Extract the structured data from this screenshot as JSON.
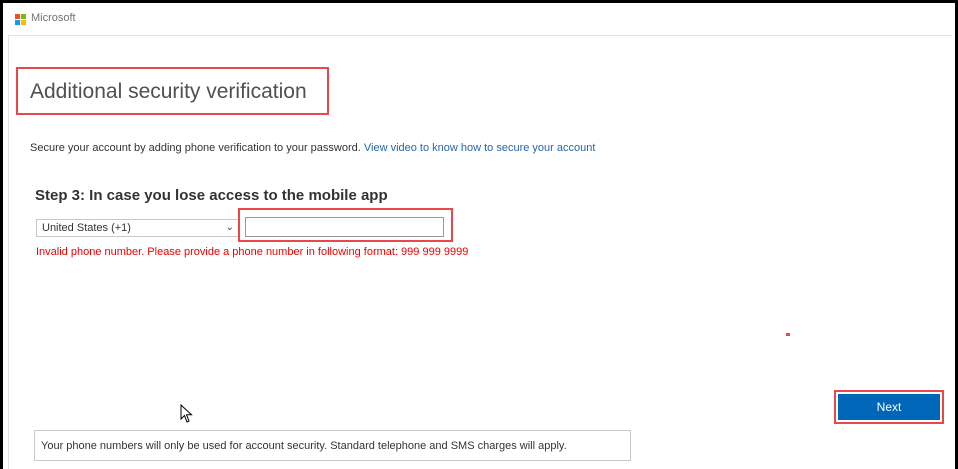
{
  "brand": {
    "name": "Microsoft",
    "logo_colors": [
      "#f25022",
      "#7fba00",
      "#00a4ef",
      "#ffb900"
    ]
  },
  "page": {
    "title": "Additional security verification",
    "intro_text": "Secure your account by adding phone verification to your password.",
    "intro_link": "View video to know how to secure your account"
  },
  "step": {
    "heading": "Step 3: In case you lose access to the mobile app",
    "country_selected": "United States (+1)",
    "phone_value": "",
    "error": "Invalid phone number. Please provide a phone number in following format: 999 999 9999"
  },
  "actions": {
    "next_label": "Next"
  },
  "footer": {
    "notice": "Your phone numbers will only be used for account security. Standard telephone and SMS charges will apply."
  },
  "colors": {
    "highlight": "#e8474b",
    "primary_button": "#0067b8",
    "link": "#2566b0",
    "error": "#e00000"
  }
}
